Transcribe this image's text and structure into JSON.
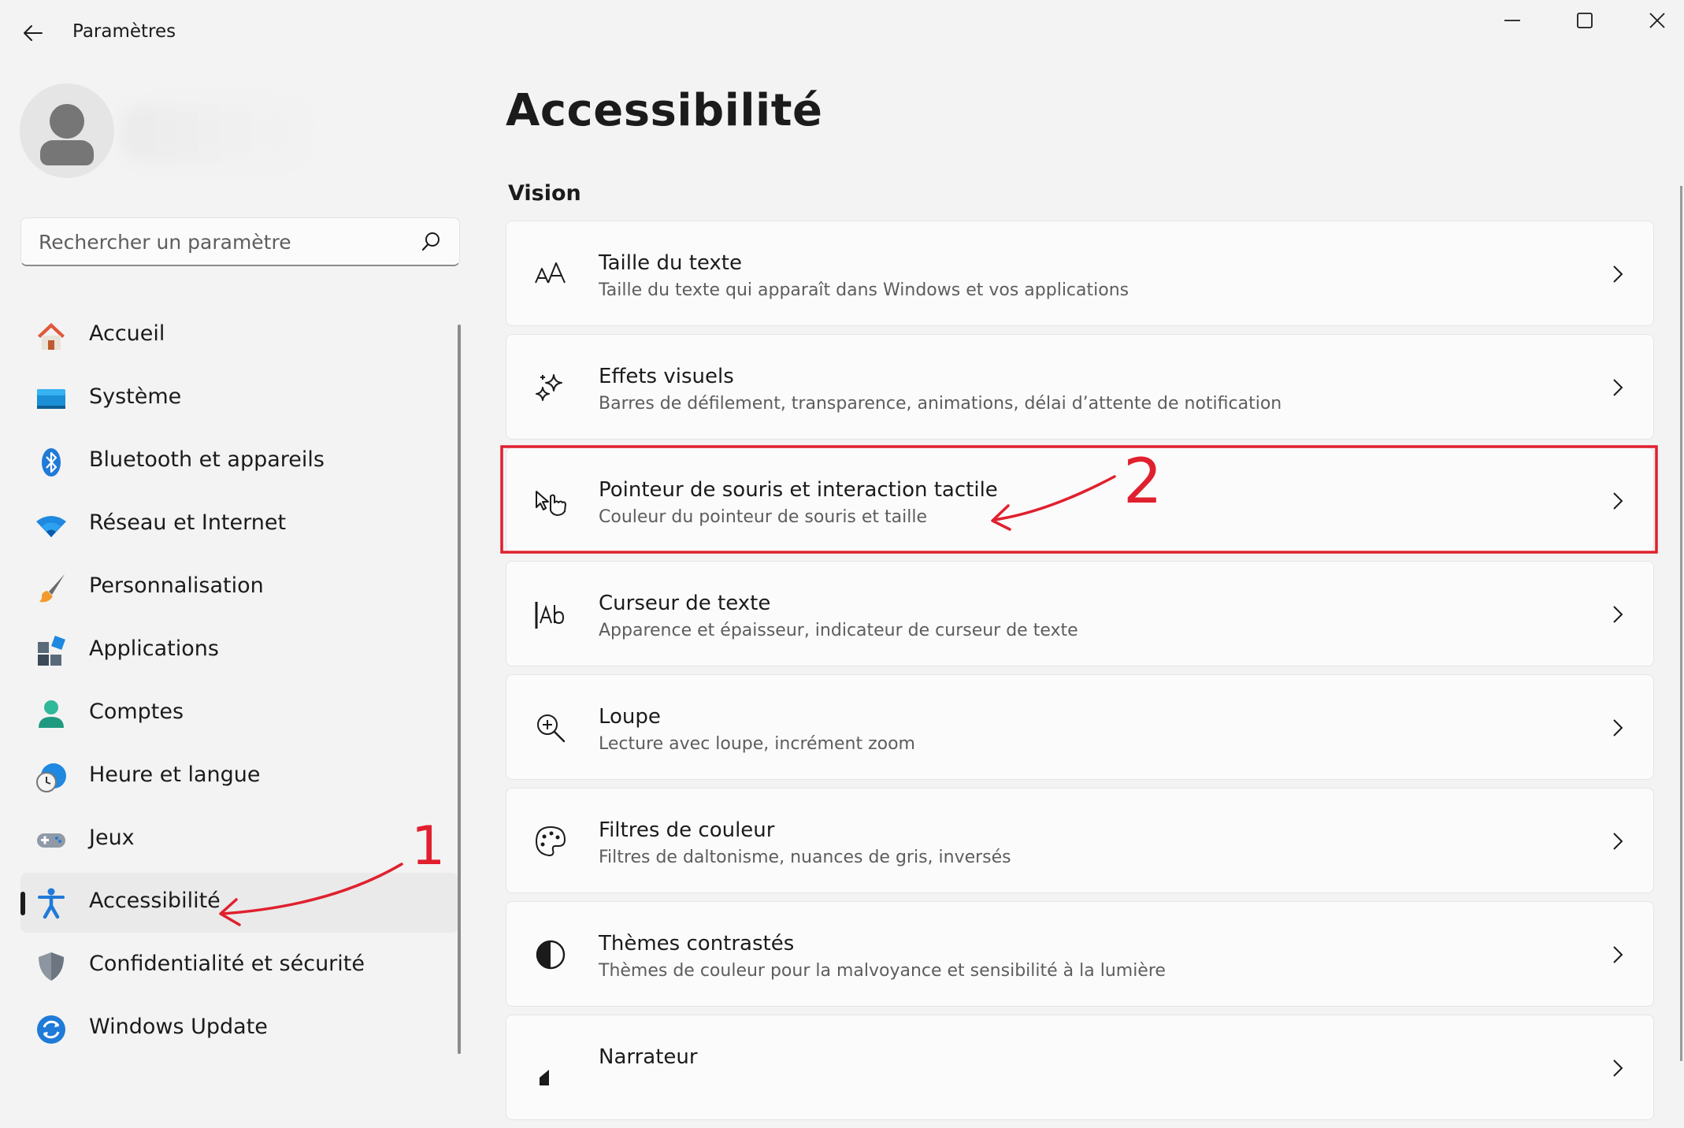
{
  "window": {
    "title": "Paramètres",
    "controls": [
      "minimize-icon",
      "maximize-icon",
      "close-icon"
    ]
  },
  "search": {
    "placeholder": "Rechercher un paramètre"
  },
  "sidebar": {
    "items": [
      {
        "label": "Accueil",
        "icon": "home-icon",
        "selected": false
      },
      {
        "label": "Système",
        "icon": "system-icon",
        "selected": false
      },
      {
        "label": "Bluetooth et appareils",
        "icon": "bluetooth-icon",
        "selected": false
      },
      {
        "label": "Réseau et Internet",
        "icon": "wifi-icon",
        "selected": false
      },
      {
        "label": "Personnalisation",
        "icon": "brush-icon",
        "selected": false
      },
      {
        "label": "Applications",
        "icon": "apps-icon",
        "selected": false
      },
      {
        "label": "Comptes",
        "icon": "account-icon",
        "selected": false
      },
      {
        "label": "Heure et langue",
        "icon": "clock-globe-icon",
        "selected": false
      },
      {
        "label": "Jeux",
        "icon": "gamepad-icon",
        "selected": false
      },
      {
        "label": "Accessibilité",
        "icon": "accessibility-icon",
        "selected": true
      },
      {
        "label": "Confidentialité et sécurité",
        "icon": "shield-icon",
        "selected": false
      },
      {
        "label": "Windows Update",
        "icon": "update-icon",
        "selected": false
      }
    ]
  },
  "main": {
    "title": "Accessibilité",
    "section": "Vision",
    "cards": [
      {
        "title": "Taille du texte",
        "subtitle": "Taille du texte qui apparaît dans Windows et vos applications",
        "icon": "text-size-icon"
      },
      {
        "title": "Effets visuels",
        "subtitle": "Barres de défilement, transparence, animations, délai d’attente de notification",
        "icon": "sparkle-icon"
      },
      {
        "title": "Pointeur de souris et interaction tactile",
        "subtitle": "Couleur du pointeur de souris et taille",
        "icon": "pointer-touch-icon"
      },
      {
        "title": "Curseur de texte",
        "subtitle": "Apparence et épaisseur, indicateur de curseur de texte",
        "icon": "text-cursor-icon"
      },
      {
        "title": "Loupe",
        "subtitle": "Lecture avec loupe, incrément zoom",
        "icon": "magnifier-icon"
      },
      {
        "title": "Filtres de couleur",
        "subtitle": "Filtres de daltonisme, nuances de gris, inversés",
        "icon": "palette-icon"
      },
      {
        "title": "Thèmes contrastés",
        "subtitle": "Thèmes de couleur pour la malvoyance et sensibilité à la lumière",
        "icon": "contrast-icon"
      },
      {
        "title": "Narrateur",
        "subtitle": "",
        "icon": "narrator-icon"
      }
    ]
  },
  "annotations": {
    "color": "#e0202e",
    "step1": "1",
    "step2": "2"
  }
}
